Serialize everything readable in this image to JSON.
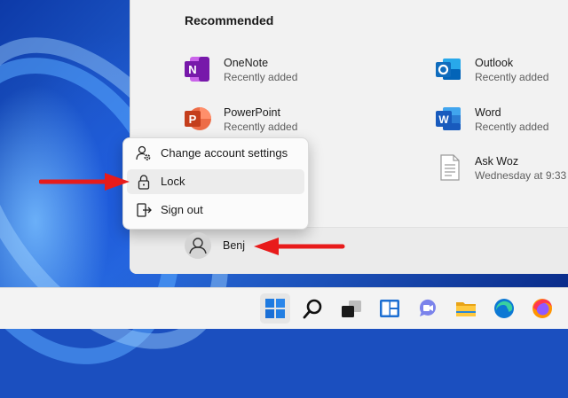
{
  "start_menu": {
    "recommended_title": "Recommended",
    "items": [
      {
        "name": "OneNote",
        "sub": "Recently added",
        "icon": "onenote-icon"
      },
      {
        "name": "Outlook",
        "sub": "Recently added",
        "icon": "outlook-icon"
      },
      {
        "name": "PowerPoint",
        "sub": "Recently added",
        "icon": "powerpoint-icon"
      },
      {
        "name": "Word",
        "sub": "Recently added",
        "icon": "word-icon"
      },
      {
        "name": "Ask Woz",
        "sub": "Wednesday at 9:33",
        "icon": "document-icon"
      }
    ]
  },
  "account_menu": {
    "items": [
      {
        "label": "Change account settings",
        "icon": "account-settings-icon"
      },
      {
        "label": "Lock",
        "icon": "lock-icon"
      },
      {
        "label": "Sign out",
        "icon": "sign-out-icon"
      }
    ]
  },
  "user": {
    "name": "Benj"
  },
  "taskbar": {
    "icons": [
      "start-icon",
      "search-icon",
      "task-view-icon",
      "widgets-icon",
      "teams-chat-icon",
      "file-explorer-icon",
      "edge-icon",
      "firefox-icon"
    ]
  },
  "colors": {
    "annotation_arrow": "#e81b1b",
    "onenote": "#7719aa",
    "outlook": "#0f6cbd",
    "powerpoint": "#c43e1c",
    "word": "#185abd"
  }
}
